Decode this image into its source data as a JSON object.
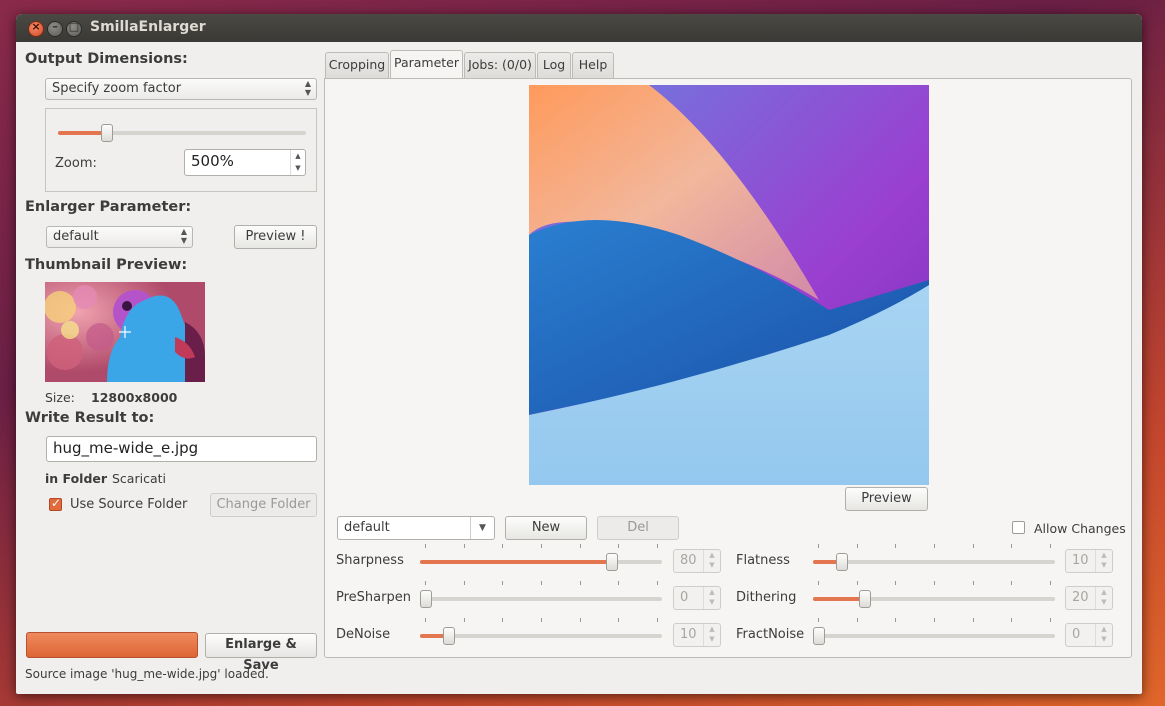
{
  "window": {
    "title": "SmillaEnlarger"
  },
  "output": {
    "heading": "Output Dimensions:",
    "mode": "Specify zoom factor",
    "zoom_label": "Zoom:",
    "zoom_value": "500%",
    "zoom_level_fraction": 0.18
  },
  "enlarger": {
    "heading": "Enlarger Parameter:",
    "preset": "default",
    "preview_button": "Preview !"
  },
  "thumbnail": {
    "heading": "Thumbnail Preview:",
    "size_label": "Size:",
    "size_value": "12800x8000"
  },
  "write": {
    "heading": "Write Result to:",
    "filename": "hug_me-wide_e.jpg",
    "folder_label": "in Folder",
    "folder_value": "Scaricati",
    "use_source_label": "Use Source Folder",
    "use_source_checked": true,
    "change_folder_button": "Change Folder"
  },
  "actions": {
    "enlarge_save": "Enlarge & Save"
  },
  "status": {
    "text": "Source image 'hug_me-wide.jpg' loaded."
  },
  "tabs": [
    {
      "label": "Cropping"
    },
    {
      "label": "Parameter",
      "active": true
    },
    {
      "label": "Jobs: (0/0)"
    },
    {
      "label": "Log"
    },
    {
      "label": "Help"
    }
  ],
  "parameter_panel": {
    "preview_button": "Preview",
    "preset": "default",
    "new_button": "New",
    "del_button": "Del",
    "allow_changes_label": "Allow Changes",
    "allow_changes_checked": false,
    "params": [
      {
        "label": "Sharpness",
        "value": "80",
        "level": 0.8
      },
      {
        "label": "PreSharpen",
        "value": "0",
        "level": 0.0
      },
      {
        "label": "DeNoise",
        "value": "10",
        "level": 0.1
      },
      {
        "label": "Flatness",
        "value": "10",
        "level": 0.1
      },
      {
        "label": "Dithering",
        "value": "20",
        "level": 0.2
      },
      {
        "label": "FractNoise",
        "value": "0",
        "level": 0.0
      }
    ]
  },
  "colors": {
    "accent": "#e3764f",
    "window_bg": "#f0efed",
    "titlebar": "#3f3e3a"
  }
}
